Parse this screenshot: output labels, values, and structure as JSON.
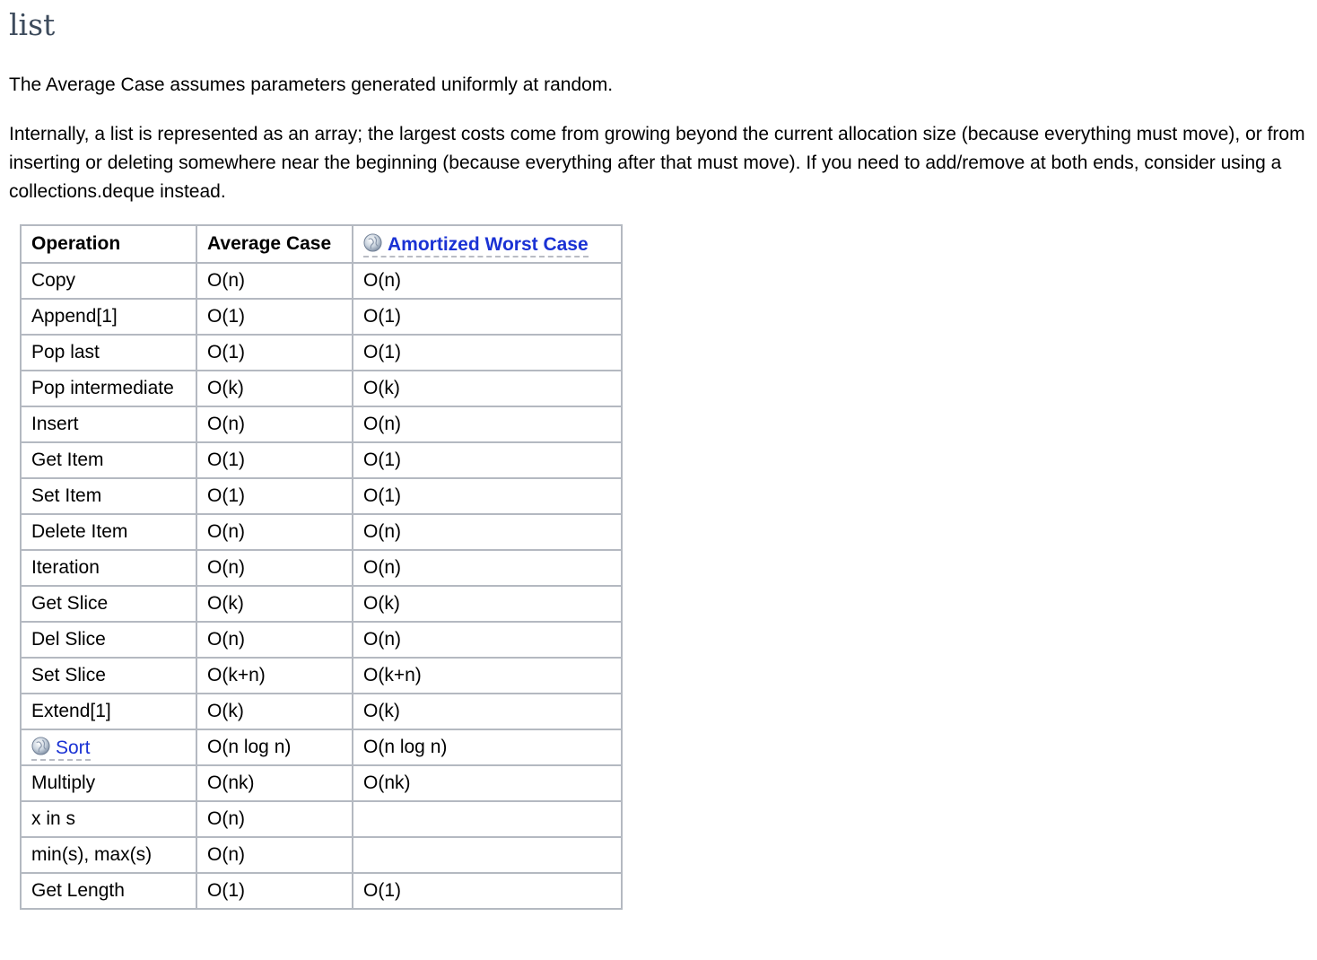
{
  "heading": "list",
  "intro": "The Average Case assumes parameters generated uniformly at random.",
  "description": "Internally, a list is represented as an array; the largest costs come from growing beyond the current allocation size (because everything must move), or from inserting or deleting somewhere near the beginning (because everything after that must move). If you need to add/remove at both ends, consider using a collections.deque instead.",
  "table": {
    "headers": {
      "operation": "Operation",
      "average": "Average Case",
      "amortized": "Amortized Worst Case"
    },
    "rows": [
      {
        "op": "Copy",
        "avg": "O(n)",
        "worst": "O(n)"
      },
      {
        "op": "Append[1]",
        "avg": "O(1)",
        "worst": "O(1)"
      },
      {
        "op": "Pop last",
        "avg": "O(1)",
        "worst": "O(1)"
      },
      {
        "op": "Pop intermediate",
        "avg": "O(k)",
        "worst": "O(k)"
      },
      {
        "op": "Insert",
        "avg": "O(n)",
        "worst": "O(n)"
      },
      {
        "op": "Get Item",
        "avg": "O(1)",
        "worst": "O(1)"
      },
      {
        "op": "Set Item",
        "avg": "O(1)",
        "worst": "O(1)"
      },
      {
        "op": "Delete Item",
        "avg": "O(n)",
        "worst": "O(n)"
      },
      {
        "op": "Iteration",
        "avg": "O(n)",
        "worst": "O(n)"
      },
      {
        "op": "Get Slice",
        "avg": "O(k)",
        "worst": "O(k)"
      },
      {
        "op": "Del Slice",
        "avg": "O(n)",
        "worst": "O(n)"
      },
      {
        "op": "Set Slice",
        "avg": "O(k+n)",
        "worst": "O(k+n)"
      },
      {
        "op": "Extend[1]",
        "avg": "O(k)",
        "worst": "O(k)"
      },
      {
        "op": "Sort",
        "avg": "O(n log n)",
        "worst": "O(n log n)"
      },
      {
        "op": "Multiply",
        "avg": "O(nk)",
        "worst": "O(nk)"
      },
      {
        "op": "x in s",
        "avg": "O(n)",
        "worst": ""
      },
      {
        "op": "min(s), max(s)",
        "avg": "O(n)",
        "worst": ""
      },
      {
        "op": "Get Length",
        "avg": "O(1)",
        "worst": "O(1)"
      }
    ]
  },
  "icons": {
    "link_icon": "globe-icon"
  },
  "colors": {
    "heading": "#3d4b5c",
    "link": "#1a32d4",
    "table_border": "#b4b9c1"
  }
}
